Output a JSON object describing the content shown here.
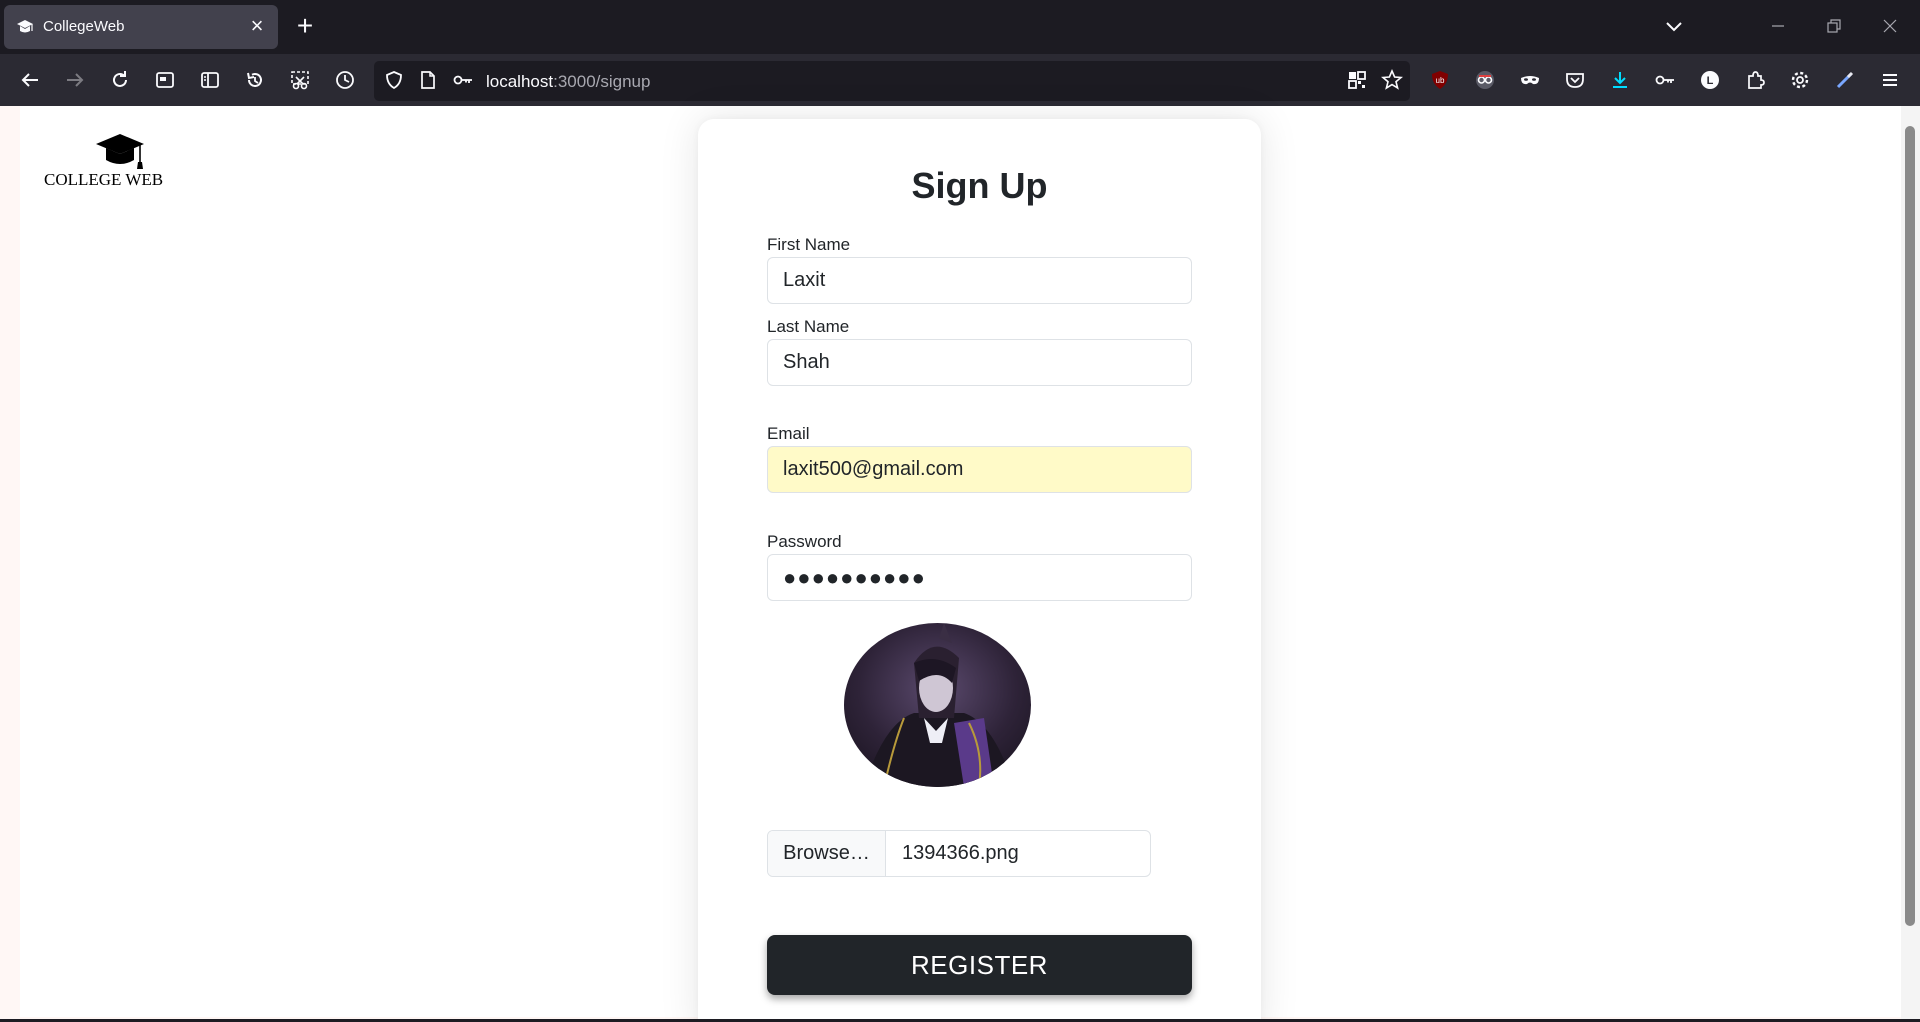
{
  "browser": {
    "tab": {
      "title": "CollegeWeb",
      "favicon": "graduation-cap-icon"
    },
    "url": {
      "host": "localhost",
      "path": ":3000/signup"
    },
    "accent_color": "#00ddff"
  },
  "logo": {
    "text": "COLLEGE WEB",
    "icon": "graduation-cap-icon"
  },
  "form": {
    "title": "Sign Up",
    "first_name": {
      "label": "First Name",
      "value": "Laxit"
    },
    "last_name": {
      "label": "Last Name",
      "value": "Shah"
    },
    "email": {
      "label": "Email",
      "value": "laxit500@gmail.com",
      "autofill_color": "#fffac8"
    },
    "password": {
      "label": "Password",
      "masked": "●●●●●●●●●●"
    },
    "avatar": {
      "icon": "avatar-image"
    },
    "file": {
      "button_label": "Browse…",
      "file_name": "1394366.png"
    },
    "submit_label": "REGISTER",
    "submit_color": "#212529"
  }
}
